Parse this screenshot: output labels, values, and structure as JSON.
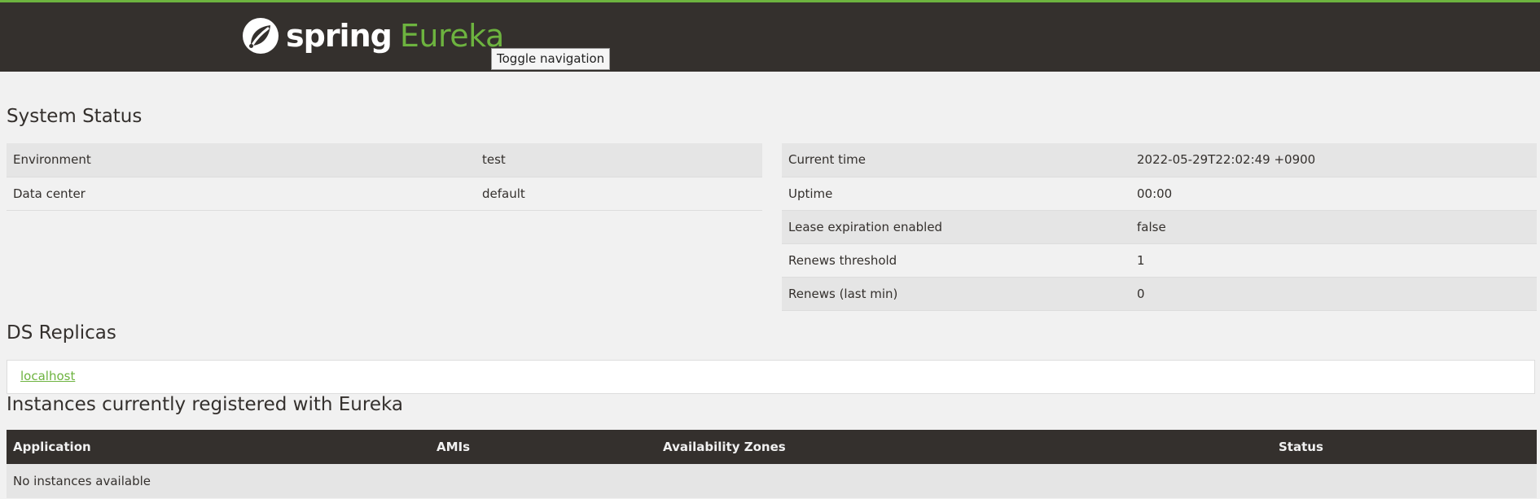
{
  "navbar": {
    "brand_spring": "spring",
    "brand_eureka": "Eureka",
    "toggle_label": "Toggle navigation",
    "accent_color": "#6db33f",
    "background_color": "#34302d"
  },
  "system_status": {
    "title": "System Status",
    "left_rows": [
      {
        "key": "Environment",
        "value": "test"
      },
      {
        "key": "Data center",
        "value": "default"
      }
    ],
    "right_rows": [
      {
        "key": "Current time",
        "value": "2022-05-29T22:02:49 +0900"
      },
      {
        "key": "Uptime",
        "value": "00:00"
      },
      {
        "key": "Lease expiration enabled",
        "value": "false"
      },
      {
        "key": "Renews threshold",
        "value": "1"
      },
      {
        "key": "Renews (last min)",
        "value": "0"
      }
    ]
  },
  "ds_replicas": {
    "title": "DS Replicas",
    "items": [
      "localhost"
    ]
  },
  "instances": {
    "title": "Instances currently registered with Eureka",
    "columns": [
      "Application",
      "AMIs",
      "Availability Zones",
      "Status"
    ],
    "empty_message": "No instances available"
  }
}
